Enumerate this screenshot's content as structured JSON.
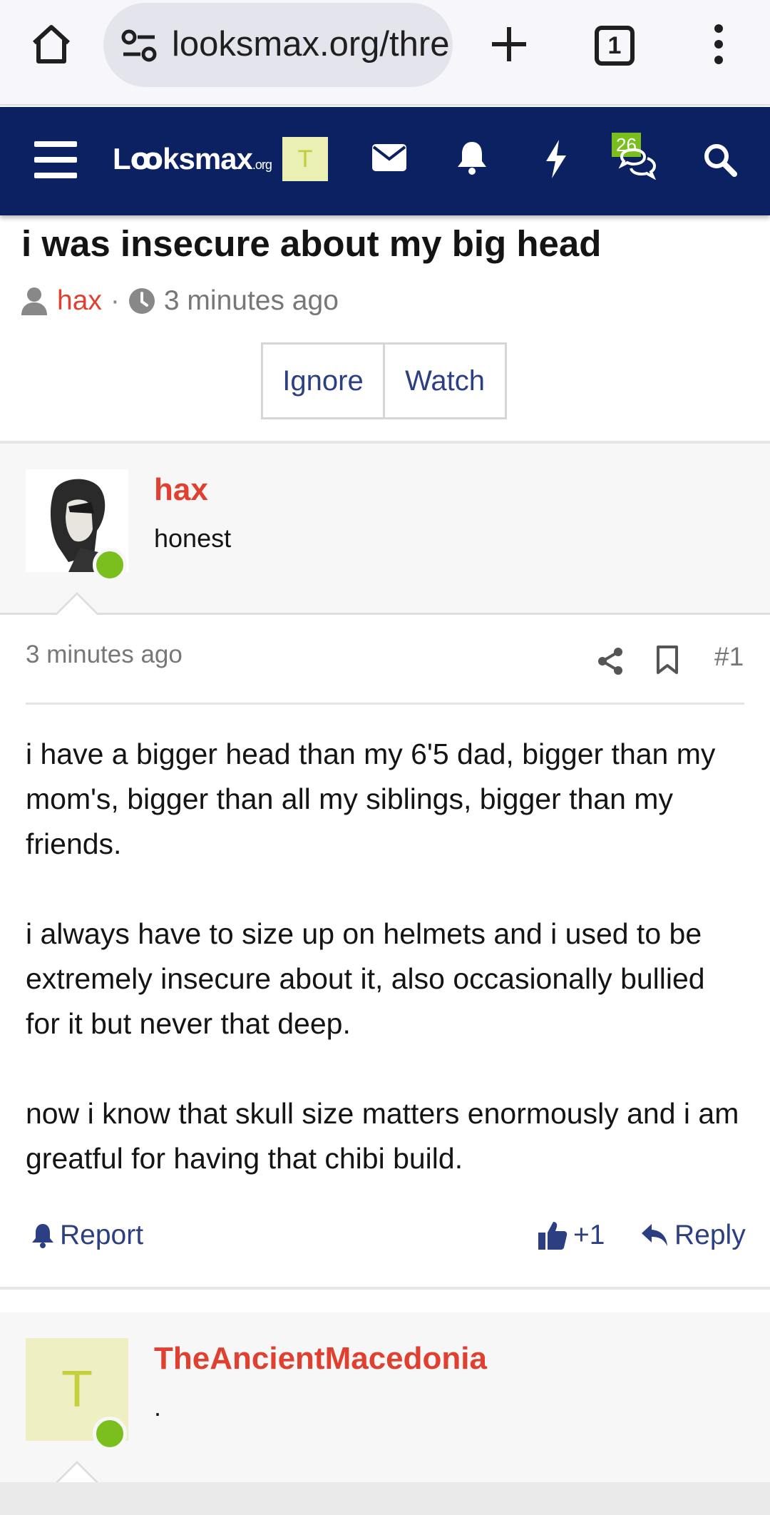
{
  "browser": {
    "url": "looksmax.org/thre",
    "tab_count": "1"
  },
  "site": {
    "logo_main": "Lꝏksmax",
    "logo_suffix": ".org",
    "avatar_letter": "T",
    "conversations_badge": "26"
  },
  "thread": {
    "title": "i was insecure about my big head",
    "author": "hax",
    "time": "3 minutes ago",
    "ignore_label": "Ignore",
    "watch_label": "Watch"
  },
  "posts": [
    {
      "username": "hax",
      "user_title": "honest",
      "time": "3 minutes ago",
      "number": "#1",
      "paragraphs": [
        "i have a bigger head than my 6'5 dad, bigger than my mom's, bigger than all my siblings, bigger than my friends.",
        "i always have to size up on helmets and i used to be extremely insecure about it, also occasionally bullied for it but never that deep.",
        "now i know that skull size matters enormously and i am greatful for having that chibi build."
      ],
      "report_label": "Report",
      "reaction_label": "+1",
      "reply_label": "Reply"
    },
    {
      "username": "TheAncientMacedonia",
      "user_title": ".",
      "avatar_letter": "T"
    }
  ],
  "colors": {
    "navbar": "#0b2161",
    "username": "#e0402f",
    "link": "#2b3f82",
    "online": "#7bbf1f"
  }
}
